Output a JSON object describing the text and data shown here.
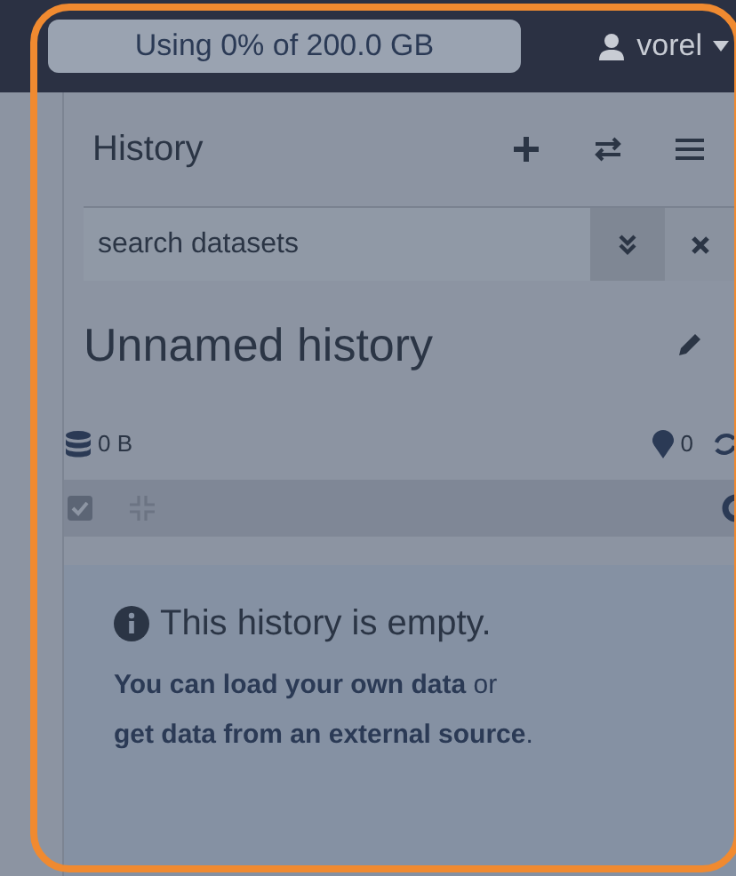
{
  "masthead": {
    "quota": "Using 0% of 200.0 GB",
    "user": "vorel"
  },
  "history_panel": {
    "title": "History",
    "search": {
      "placeholder": "search datasets"
    },
    "history_name": "Unnamed history",
    "size": "0 B",
    "deleted_count": "0"
  },
  "empty_message": {
    "title": "This history is empty.",
    "parts": [
      {
        "kind": "link",
        "text": "You can load your own data"
      },
      {
        "kind": "text",
        "text": " or "
      },
      {
        "kind": "link",
        "text": "get data from an external source"
      },
      {
        "kind": "text",
        "text": "."
      }
    ]
  }
}
